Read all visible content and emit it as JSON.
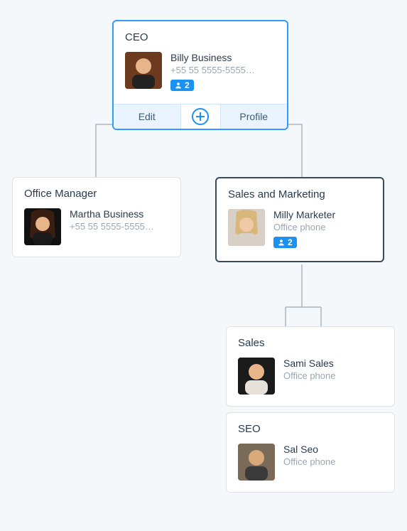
{
  "nodes": {
    "ceo": {
      "role": "CEO",
      "name": "Billy Business",
      "sub": "+55 55 5555-5555…",
      "badge_count": "2"
    },
    "office": {
      "role": "Office Manager",
      "name": "Martha Business",
      "sub": "+55 55 5555-5555…"
    },
    "salesmkt": {
      "role": "Sales and Marketing",
      "name": "Milly Marketer",
      "sub": "Office phone",
      "badge_count": "2"
    },
    "sales": {
      "role": "Sales",
      "name": "Sami Sales",
      "sub": "Office phone"
    },
    "seo": {
      "role": "SEO",
      "name": "Sal Seo",
      "sub": "Office phone"
    }
  },
  "actions": {
    "edit": "Edit",
    "profile": "Profile"
  }
}
